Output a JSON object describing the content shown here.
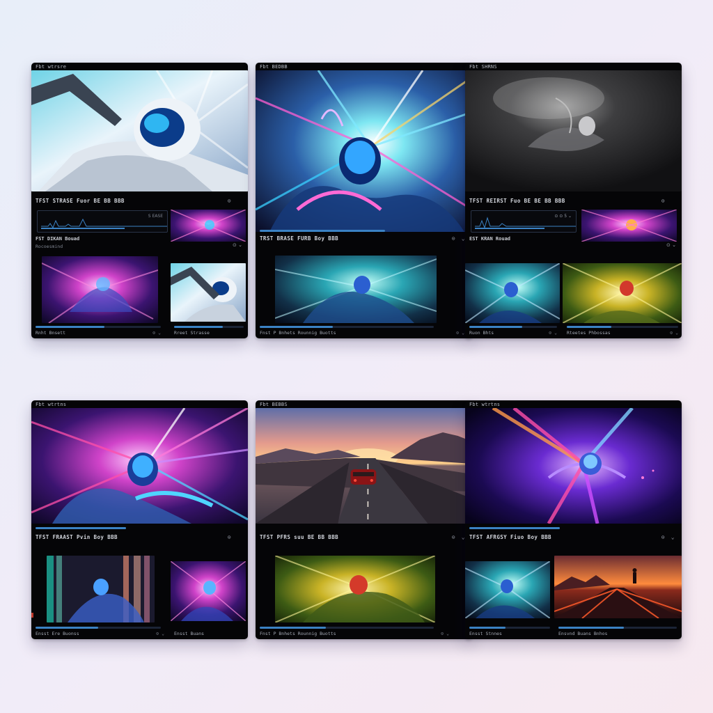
{
  "cards": [
    {
      "title": "Fbt wtrsre",
      "row_title": "TFST STRASE Fuor BE BB BBB",
      "row_icon": "⊙",
      "row_chev": "⌄",
      "wave_label": "S EASE",
      "sub_title": "FST DIKAN Bouad",
      "sub_caption": "Rocoesmind",
      "sub_icon": "⊙ ⌄",
      "footer_left": "Rnht Bnsett",
      "footer_left_icon": "⊙ ⌄",
      "footer_right": "Rreet Strasse",
      "footer_right_icon": "⊙ ⌄",
      "progress_left": 0.55,
      "progress_right": 0.7
    },
    {
      "title": "Fbt BEDBB",
      "row_title": "TRST BRASE FURB Boy BBB",
      "row_icon": "⊙",
      "row_chev": "⌄",
      "footer_left": "Fnst P Bnhets Rounnig Buotts",
      "footer_left_icon": "⊙ ⌄",
      "progress_left": 0.42
    },
    {
      "title": "Fbt SHRNS",
      "row_title": "TFST REIRST Fuo BE BE BB BBB",
      "row_icon": "⊙",
      "row_chev": "⌄",
      "wave_label": "⊙ ⊙ 5 ⌄",
      "sub_title": "EST KRAN Rouad",
      "sub_caption": "",
      "sub_icon": "⊙ ⌄",
      "footer_left": "Ruon Bhts",
      "footer_left_icon": "⊙ ⌄",
      "footer_right": "Rteetes Phbossas",
      "footer_right_icon": "⊙ ⌄",
      "progress_left": 0.6,
      "progress_right": 0.4
    },
    {
      "title": "Fbt wtrtns",
      "row_title": "TFST FRAAST Pvin Boy BBB",
      "row_icon": "⊙",
      "row_chev": "⌄",
      "footer_left": "Ensst Ere Buonss",
      "footer_left_icon": "⊙ ⌄",
      "footer_right": "Ensst Buans",
      "footer_right_icon": "",
      "progress_left": 0.5,
      "progress_right": 0.6
    },
    {
      "title": "Fbt BEBBS",
      "row_title": "TFST PFRS suu BE BB BBB",
      "row_icon": "⊙",
      "row_chev": "⌄",
      "footer_left": "Fnst P Bnhets Rounnig Buotts",
      "footer_left_icon": "⊙ ⌄",
      "progress_left": 0.38
    },
    {
      "title": "Fbt wtrtns",
      "row_title": "TFST AFRGSY Fiuo Boy BBB",
      "row_icon": "⊙",
      "row_chev": "⌄",
      "footer_left": "Ensst Stnnes",
      "footer_left_icon": "",
      "footer_right": "Ensvnd Buans Bnhos",
      "footer_right_icon": "",
      "progress_left": 0.45,
      "progress_right": 0.55
    }
  ]
}
